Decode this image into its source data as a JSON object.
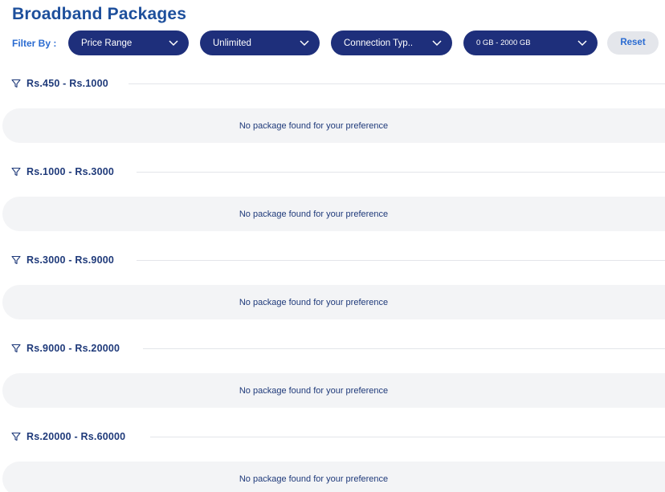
{
  "page": {
    "title": "Broadband Packages"
  },
  "filters": {
    "label": "Filter By :",
    "dropdowns": [
      {
        "value": "Price Range"
      },
      {
        "value": "Unlimited"
      },
      {
        "value": "Connection Typ.."
      },
      {
        "value": "0 GB - 2000 GB"
      }
    ],
    "reset_label": "Reset"
  },
  "groups": [
    {
      "range": "Rs.450 - Rs.1000",
      "empty_message": "No package found for your preference"
    },
    {
      "range": "Rs.1000 - Rs.3000",
      "empty_message": "No package found for your preference"
    },
    {
      "range": "Rs.3000 - Rs.9000",
      "empty_message": "No package found for your preference"
    },
    {
      "range": "Rs.9000 - Rs.20000",
      "empty_message": "No package found for your preference"
    },
    {
      "range": "Rs.20000 - Rs.60000",
      "empty_message": "No package found for your preference"
    }
  ],
  "icons": {
    "dropdown": "chevron-down-icon",
    "group": "filter-icon"
  },
  "colors": {
    "dropdown_bg": "#1e2f7b",
    "accent": "#2a6bd1",
    "title": "#1d4f9c",
    "reset_bg": "#e4e6eb",
    "empty_bg": "#f3f4f6"
  }
}
